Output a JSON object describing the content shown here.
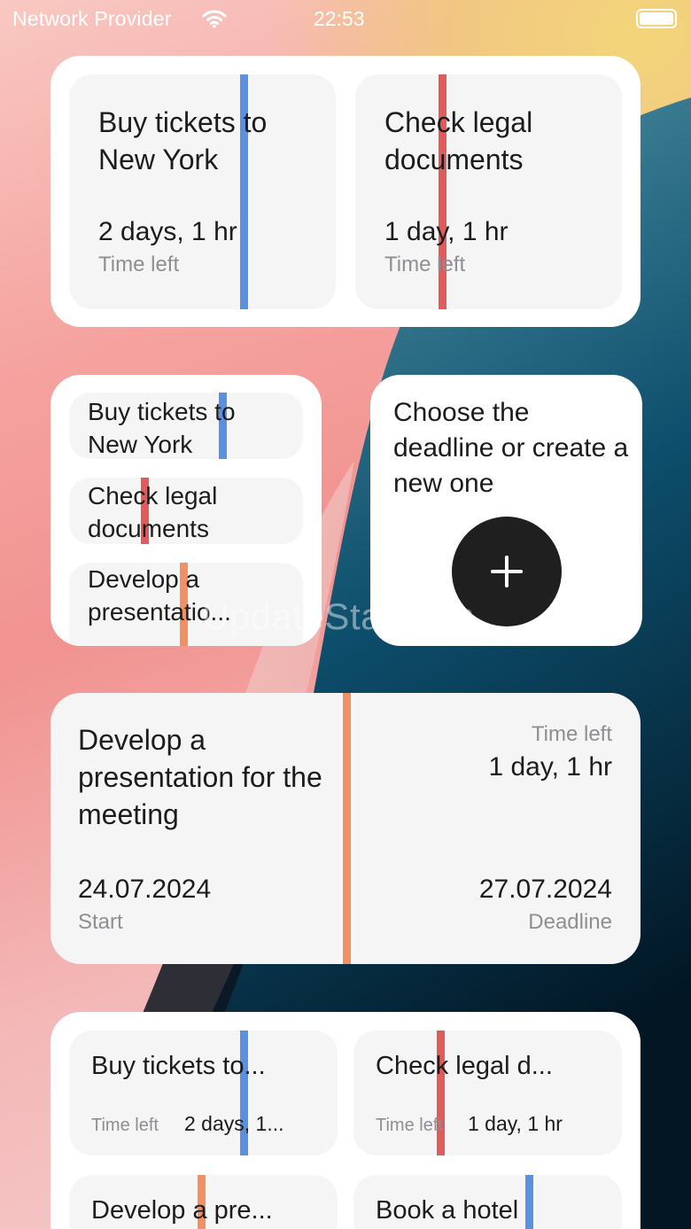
{
  "status_bar": {
    "carrier": "Network Provider",
    "time": "22:53"
  },
  "colors": {
    "blue": "#5b8fe0",
    "red": "#e25a5a",
    "orange": "#f09063"
  },
  "large_widget": {
    "tasks": [
      {
        "title": "Buy tickets to New York",
        "time_left": "2 days, 1 hr",
        "time_label": "Time left",
        "color": "blue"
      },
      {
        "title": "Check legal documents",
        "time_left": "1 day, 1 hr",
        "time_label": "Time left",
        "color": "red"
      }
    ]
  },
  "list_widget": {
    "items": [
      {
        "title": "Buy tickets to New York",
        "color": "blue"
      },
      {
        "title": "Check legal documents",
        "color": "red"
      },
      {
        "title": "Develop a presentatio...",
        "color": "orange"
      }
    ]
  },
  "add_widget": {
    "prompt": "Choose the deadline or create a new one",
    "button_icon": "plus-icon"
  },
  "detail_widget": {
    "title": "Develop a presentation for the meeting",
    "time_label": "Time left",
    "time_left": "1 day, 1 hr",
    "start_date": "24.07.2024",
    "start_label": "Start",
    "deadline_date": "27.07.2024",
    "deadline_label": "Deadline",
    "color": "orange"
  },
  "grid_widget": {
    "tiles": [
      {
        "title": "Buy tickets to...",
        "time_label": "Time left",
        "time_left": "2 days, 1...",
        "color": "blue"
      },
      {
        "title": "Check legal d...",
        "time_label": "Time left",
        "time_left": "1 day, 1 hr",
        "color": "red"
      },
      {
        "title": "Develop a pre...",
        "color": "orange"
      },
      {
        "title": "Book a hotel",
        "color": "blue"
      }
    ]
  },
  "watermark": "UpdateStar.com"
}
